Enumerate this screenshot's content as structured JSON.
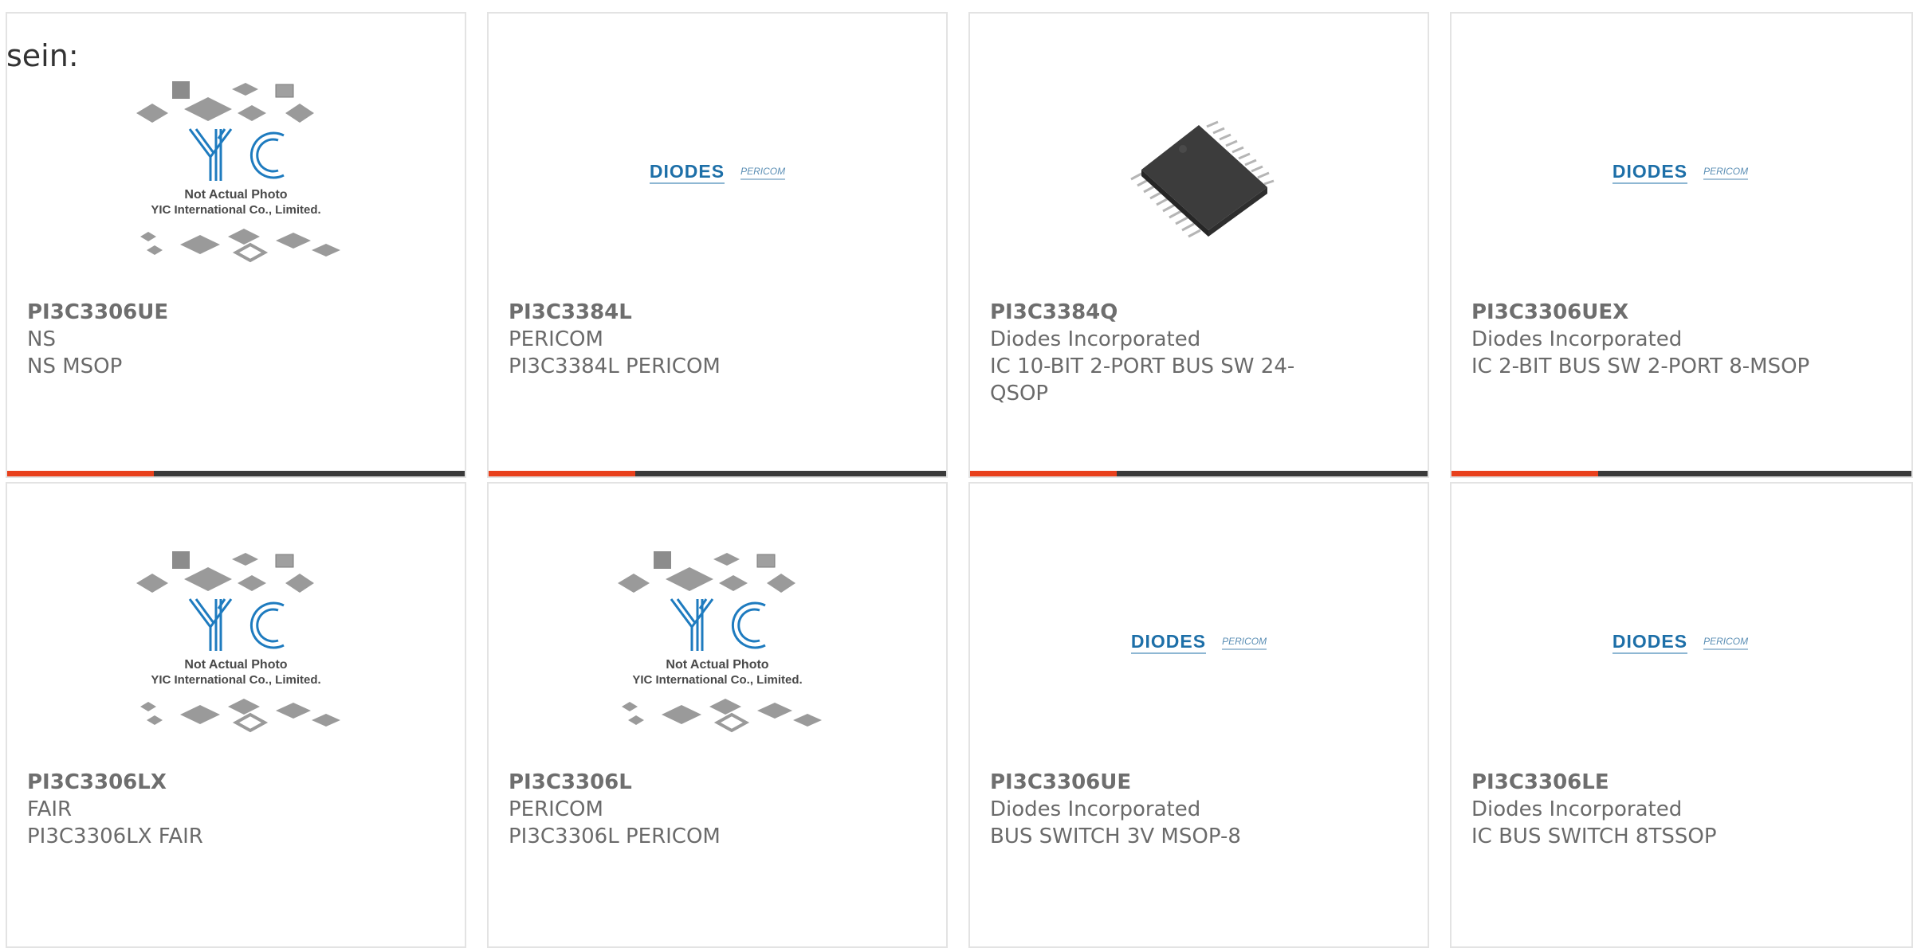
{
  "intro_text": "sein:",
  "accent_color": "#e8401c",
  "rows": [
    [
      {
        "part": "PI3C3306UE",
        "manufacturer": "NS",
        "description": "NS MSOP",
        "image": "yic-placeholder",
        "image_caption": "Not Actual Photo",
        "image_caption2": "YIC International Co., Limited."
      },
      {
        "part": "PI3C3384L",
        "manufacturer": "PERICOM",
        "description": "PI3C3384L PERICOM",
        "image": "diodes-pericom-logo",
        "logo_main": "DIODES",
        "logo_second": "PERICOM"
      },
      {
        "part": "PI3C3384Q",
        "manufacturer": "Diodes Incorporated",
        "description": "IC 10-BIT 2-PORT BUS SW 24-QSOP",
        "image": "ic-chip-photo"
      },
      {
        "part": "PI3C3306UEX",
        "manufacturer": "Diodes Incorporated",
        "description": "IC 2-BIT BUS SW 2-PORT 8-MSOP",
        "image": "diodes-pericom-logo",
        "logo_main": "DIODES",
        "logo_second": "PERICOM"
      }
    ],
    [
      {
        "part": "PI3C3306LX",
        "manufacturer": "FAIR",
        "description": "PI3C3306LX FAIR",
        "image": "yic-placeholder",
        "image_caption": "Not Actual Photo",
        "image_caption2": "YIC International Co., Limited."
      },
      {
        "part": "PI3C3306L",
        "manufacturer": "PERICOM",
        "description": "PI3C3306L PERICOM",
        "image": "yic-placeholder",
        "image_caption": "Not Actual Photo",
        "image_caption2": "YIC International Co., Limited."
      },
      {
        "part": "PI3C3306UE",
        "manufacturer": "Diodes Incorporated",
        "description": "BUS SWITCH 3V MSOP-8",
        "image": "diodes-pericom-logo",
        "logo_main": "DIODES",
        "logo_second": "PERICOM"
      },
      {
        "part": "PI3C3306LE",
        "manufacturer": "Diodes Incorporated",
        "description": "IC BUS SWITCH 8TSSOP",
        "image": "diodes-pericom-logo",
        "logo_main": "DIODES",
        "logo_second": "PERICOM"
      }
    ]
  ]
}
